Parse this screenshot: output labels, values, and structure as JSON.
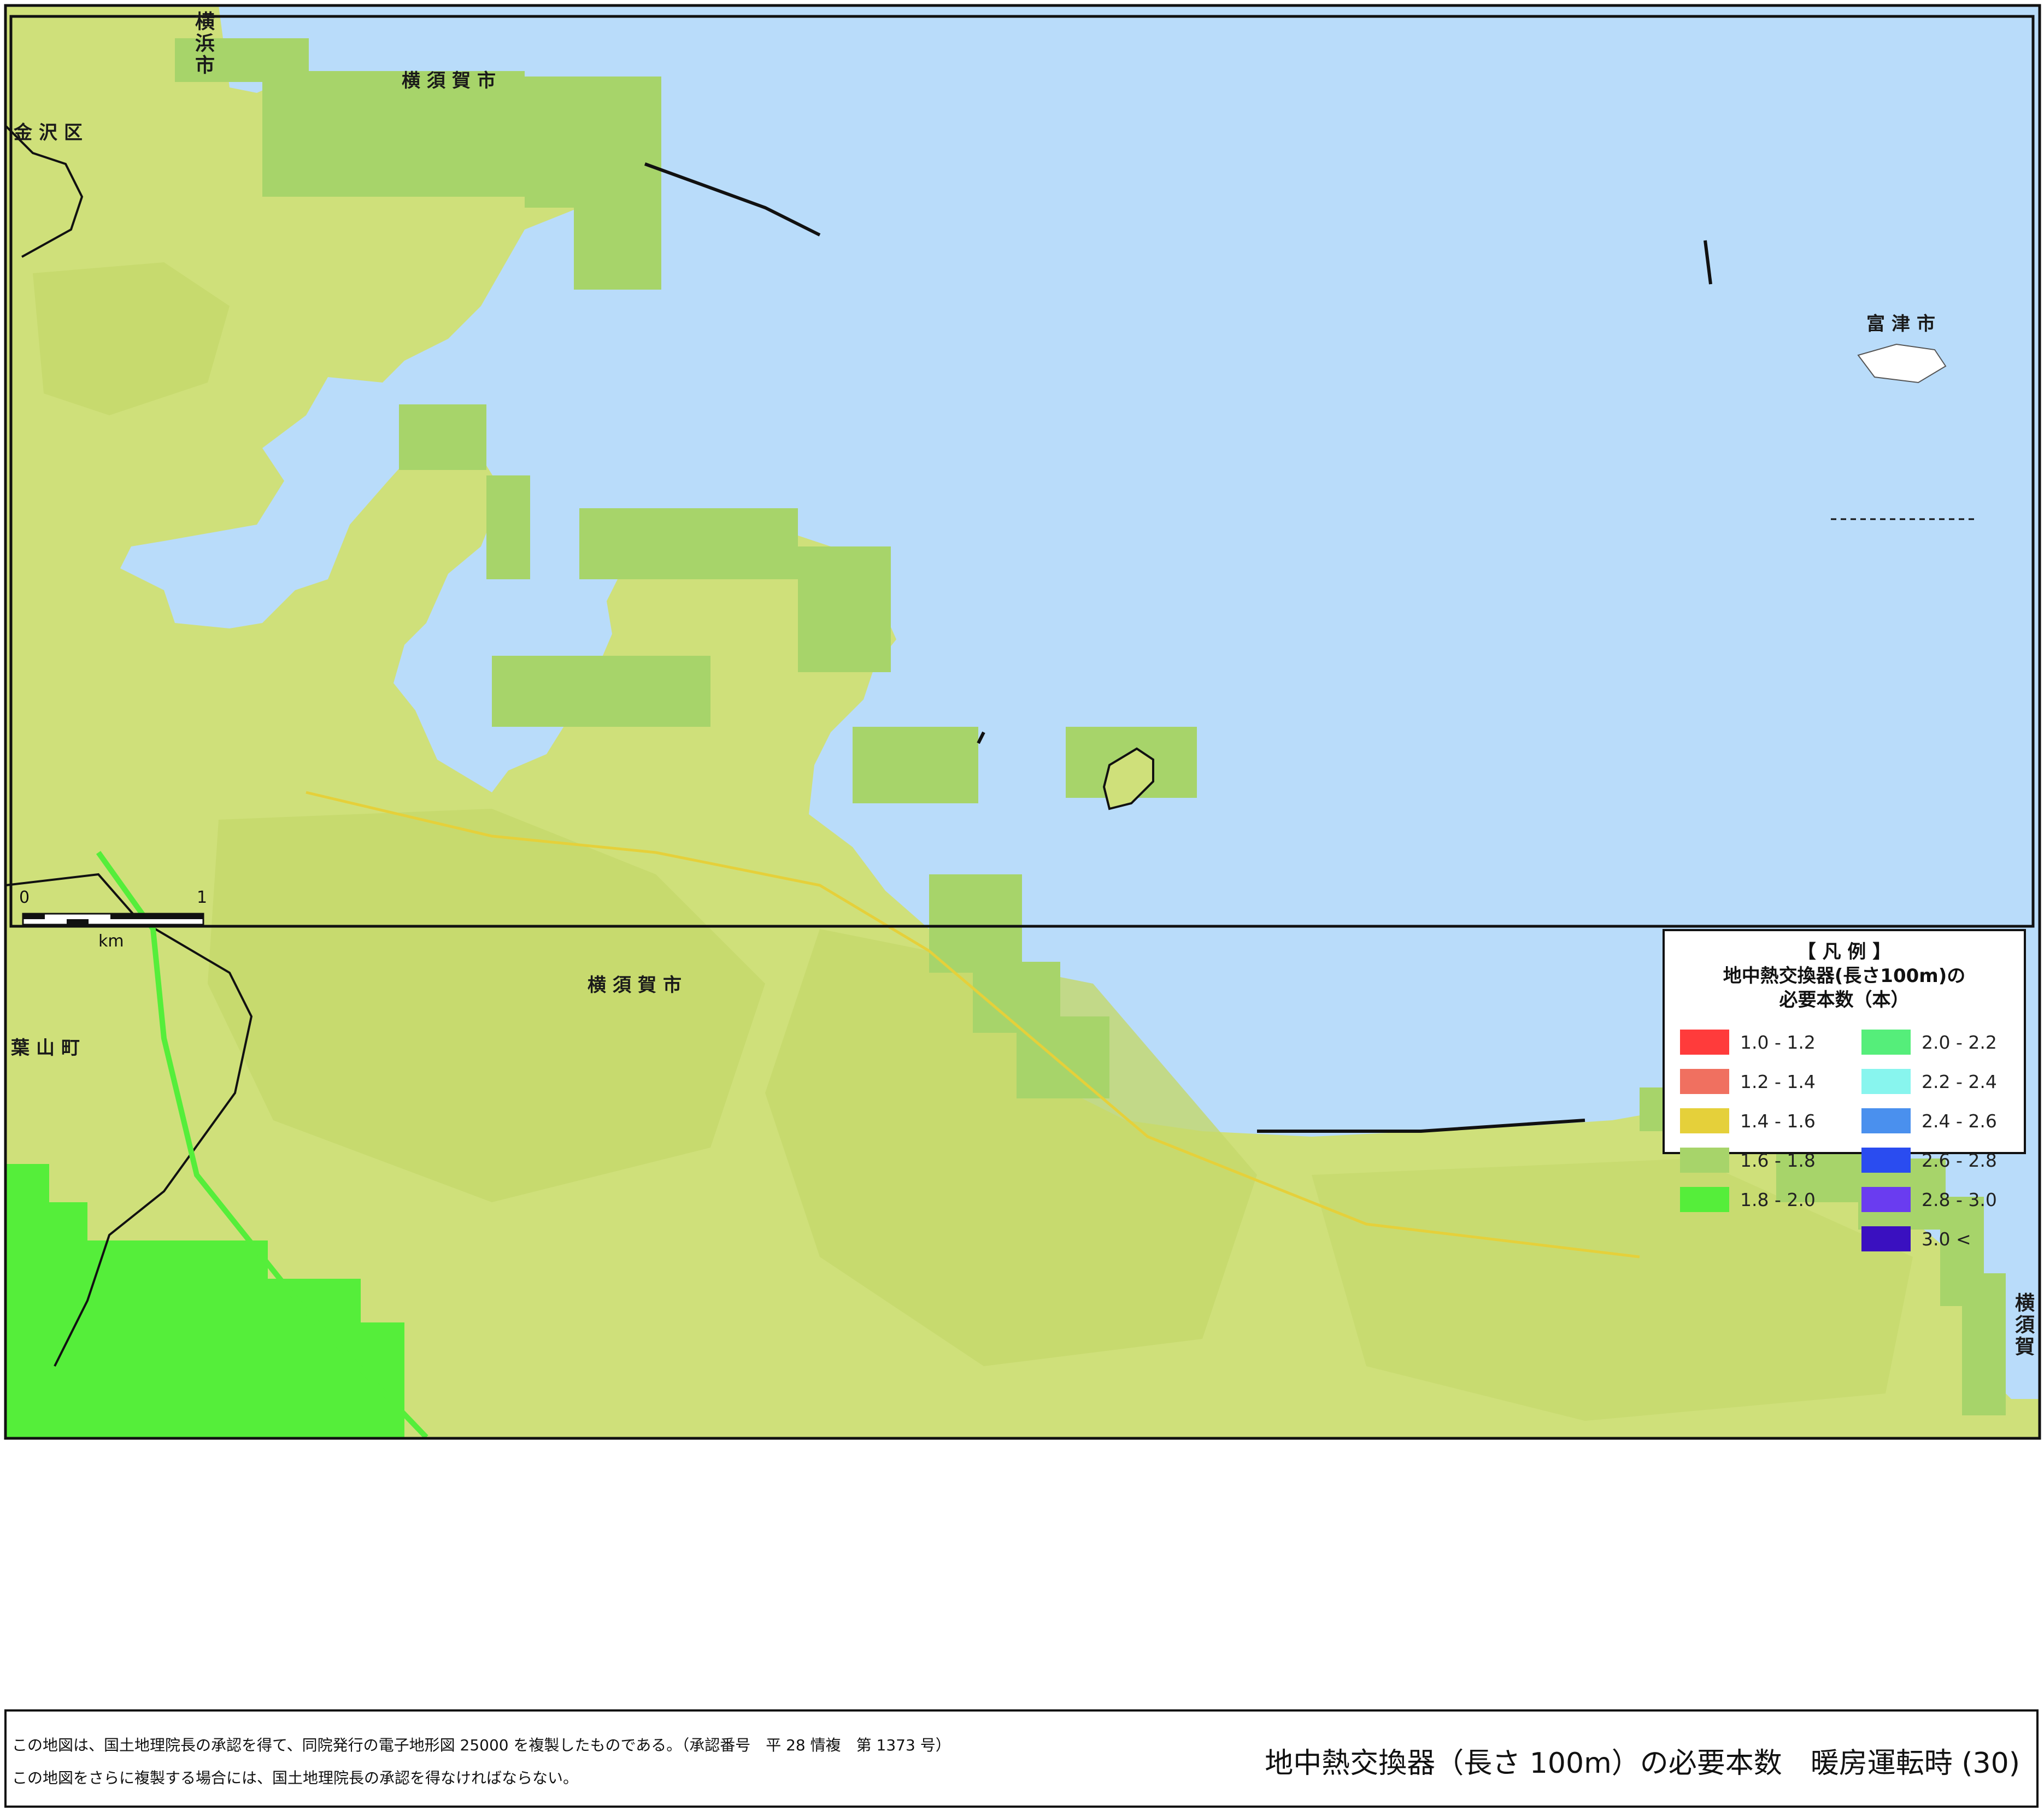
{
  "place_labels": {
    "yokohama_shi_top": "横浜市",
    "kanazawa_ku": "金沢区",
    "yokosuka_shi_north": "横須賀市",
    "yokosuka_shi_center": "横須賀市",
    "futtsu_shi": "富津市",
    "hayama_machi": "葉山町",
    "yokosuka_right": "横須賀"
  },
  "scale_bar": {
    "start_label": "0",
    "end_label": "1",
    "unit_label": "km"
  },
  "legend": {
    "title_line1": "【 凡 例 】",
    "title_line2": "地中熱交換器(長さ100m)の",
    "title_line3": "必要本数（本）",
    "items": [
      {
        "label": "1.0  -  1.2",
        "color": "#ff3b3b"
      },
      {
        "label": "1.2  -  1.4",
        "color": "#f07060"
      },
      {
        "label": "1.4  -  1.6",
        "color": "#e5d03a"
      },
      {
        "label": "1.6  -  1.8",
        "color": "#a7d46a"
      },
      {
        "label": "1.8  -  2.0",
        "color": "#55ee3a"
      },
      {
        "label": "2.0  -  2.2",
        "color": "#55ee7a"
      },
      {
        "label": "2.2  -  2.4",
        "color": "#88f5ee"
      },
      {
        "label": "2.4  -  2.6",
        "color": "#4a90ee"
      },
      {
        "label": "2.6  -  2.8",
        "color": "#2a4cf0"
      },
      {
        "label": "2.8  -  3.0",
        "color": "#6a3cf0"
      },
      {
        "label": "3.0 <",
        "color": "#3a10c0"
      }
    ]
  },
  "footer": {
    "note_line1": "この地図は、国土地理院長の承認を得て、同院発行の電子地形図 25000 を複製したものである。（承認番号　平 28 情複　第 1373 号）",
    "note_line2": "この地図をさらに複製する場合には、国土地理院長の承認を得なければならない。",
    "map_title": "地中熱交換器（長さ 100m）の必要本数　暖房運転時 (30)"
  },
  "colors": {
    "sea": "#b9dcfa",
    "land_main": "#cfe07a",
    "land_shade": "#bfd268",
    "cell_1_6_1_8": "#a7d46a",
    "cell_1_8_2_0": "#55ee3a",
    "frame": "#111111"
  }
}
